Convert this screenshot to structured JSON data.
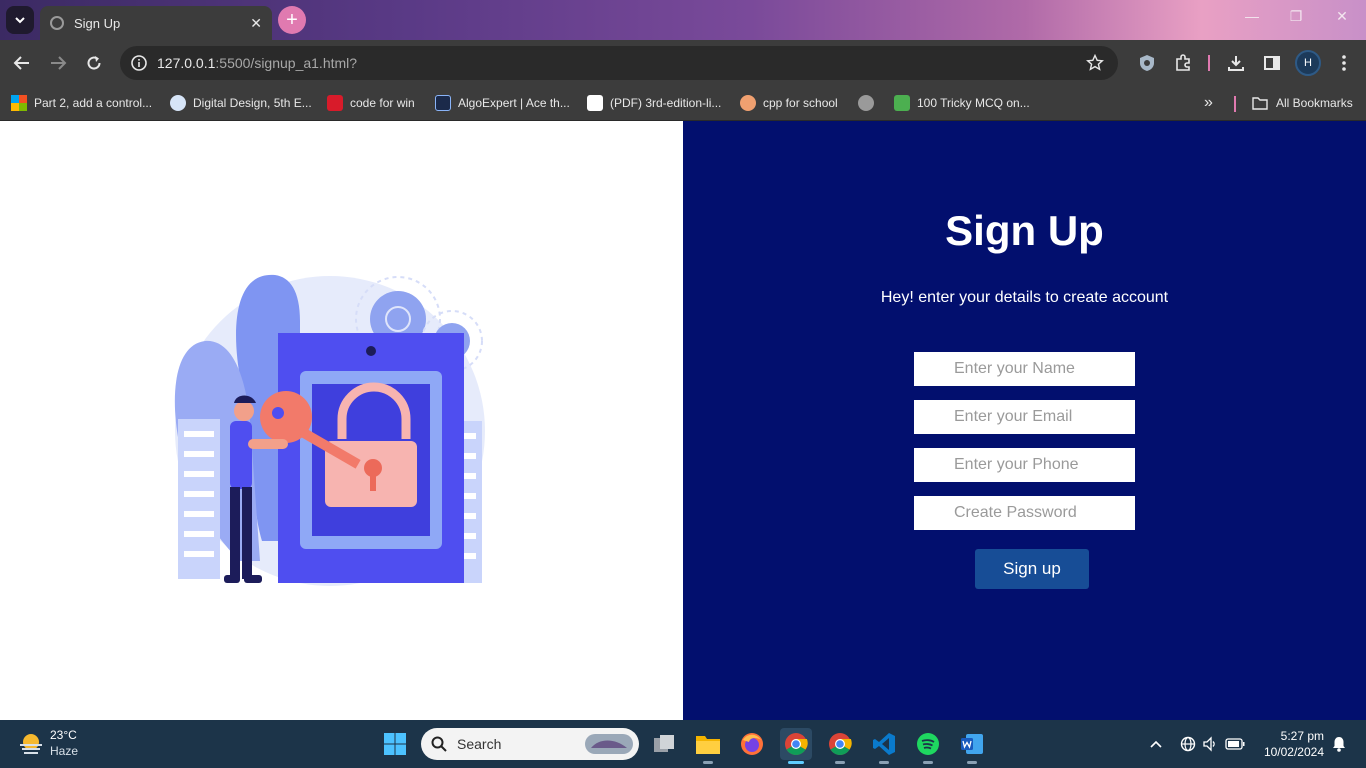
{
  "browser": {
    "tab": {
      "title": "Sign Up",
      "close_glyph": "✕"
    },
    "new_tab_glyph": "+",
    "window_controls": {
      "minimize": "—",
      "maximize": "❐",
      "close": "✕"
    },
    "address": {
      "host": "127.0.0.1",
      "rest": ":5500/signup_a1.html?"
    },
    "profile_initial": "H",
    "bookmarks": [
      {
        "label": "Part 2, add a control...",
        "icon": "microsoft-icon"
      },
      {
        "label": "Digital Design, 5th E...",
        "icon": "dropbox-icon"
      },
      {
        "label": "code for win",
        "icon": "flag-icon"
      },
      {
        "label": "AlgoExpert | Ace th...",
        "icon": "algoexpert-icon"
      },
      {
        "label": "(PDF) 3rd-edition-li...",
        "icon": "academia-icon"
      },
      {
        "label": "cpp for school",
        "icon": "cpp-icon"
      },
      {
        "label": "",
        "icon": "globe-icon"
      },
      {
        "label": "100 Tricky MCQ on...",
        "icon": "codingblocks-icon"
      }
    ],
    "overflow_glyph": "»",
    "all_bookmarks": "All Bookmarks"
  },
  "page": {
    "heading": "Sign Up",
    "subtext": "Hey! enter your details to create account",
    "fields": {
      "name_placeholder": "Enter your Name",
      "email_placeholder": "Enter your Email",
      "phone_placeholder": "Enter your Phone",
      "password_placeholder": "Create Password"
    },
    "submit_label": "Sign up",
    "colors": {
      "panel": "#020f6e",
      "button": "#174d96"
    }
  },
  "taskbar": {
    "weather_temp": "23°C",
    "weather_cond": "Haze",
    "search_label": "Search",
    "clock_time": "5:27 pm",
    "clock_date": "10/02/2024"
  }
}
